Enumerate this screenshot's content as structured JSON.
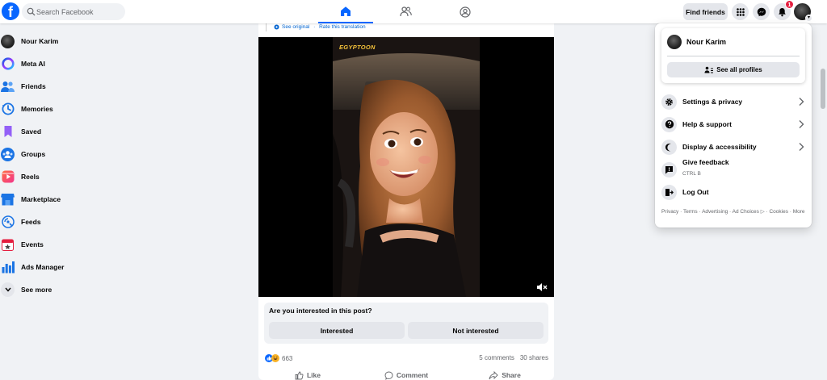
{
  "topbar": {
    "logo_letter": "f",
    "search_placeholder": "Search Facebook",
    "find_friends_label": "Find friends",
    "notification_count": "1"
  },
  "sidebar": {
    "items": [
      {
        "label": "Nour Karim",
        "icon": "profile-avatar-icon"
      },
      {
        "label": "Meta AI",
        "icon": "meta-ai-icon"
      },
      {
        "label": "Friends",
        "icon": "friends-icon"
      },
      {
        "label": "Memories",
        "icon": "memories-icon"
      },
      {
        "label": "Saved",
        "icon": "saved-icon"
      },
      {
        "label": "Groups",
        "icon": "groups-icon"
      },
      {
        "label": "Reels",
        "icon": "reels-icon"
      },
      {
        "label": "Marketplace",
        "icon": "marketplace-icon"
      },
      {
        "label": "Feeds",
        "icon": "feeds-icon"
      },
      {
        "label": "Events",
        "icon": "events-icon"
      },
      {
        "label": "Ads Manager",
        "icon": "ads-manager-icon"
      },
      {
        "label": "See more",
        "icon": "chevron-down-icon"
      }
    ]
  },
  "post": {
    "see_original": "See original",
    "separator": " · ",
    "rate_translation": "Rate this translation",
    "video_watermark": "EGYPTOON",
    "interest_question": "Are you interested in this post?",
    "interested_label": "Interested",
    "not_interested_label": "Not interested",
    "reaction_count": "663",
    "comments": "5 comments",
    "shares": "30 shares",
    "like_label": "Like",
    "comment_label": "Comment",
    "share_label": "Share"
  },
  "dropdown": {
    "profile_name": "Nour Karim",
    "see_all_profiles": "See all profiles",
    "menu": [
      {
        "label": "Settings & privacy",
        "icon": "gear-icon",
        "has_chevron": true
      },
      {
        "label": "Help & support",
        "icon": "question-icon",
        "has_chevron": true
      },
      {
        "label": "Display & accessibility",
        "icon": "moon-icon",
        "has_chevron": true
      },
      {
        "label": "Give feedback",
        "sub": "CTRL B",
        "icon": "feedback-icon",
        "has_chevron": false
      },
      {
        "label": "Log Out",
        "icon": "logout-icon",
        "has_chevron": false
      }
    ],
    "footer": "Privacy · Terms · Advertising · Ad Choices ▷ · Cookies · More"
  },
  "colors": {
    "brand_blue": "#0866ff",
    "background": "#f0f2f5",
    "button_gray": "#e4e6eb",
    "notification_red": "#e41e3f"
  }
}
